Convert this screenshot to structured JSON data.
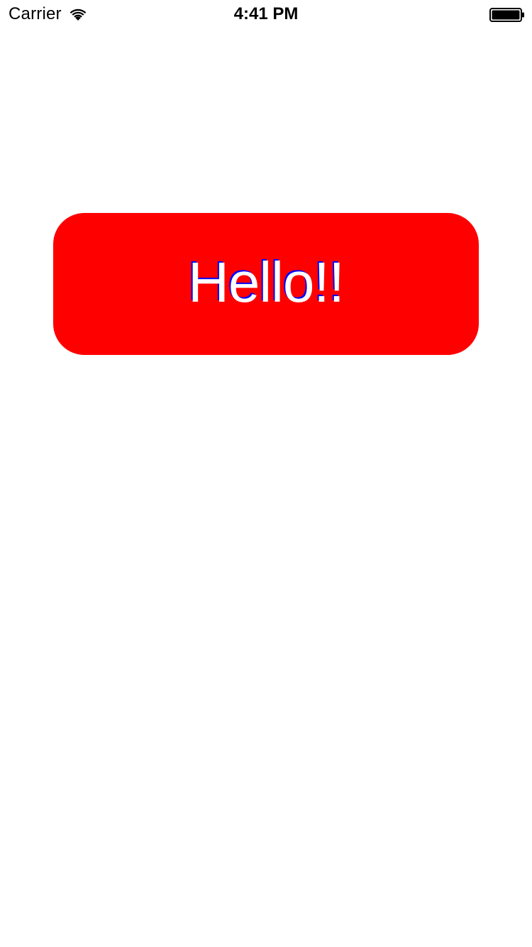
{
  "status_bar": {
    "carrier": "Carrier",
    "time": "4:41 PM",
    "icons": {
      "wifi": "wifi-icon",
      "battery": "battery-icon"
    }
  },
  "main": {
    "button": {
      "label": "Hello!!",
      "background_color": "#ff0000",
      "text_color": "#ffffff",
      "shadow_color": "#0000ff"
    }
  }
}
